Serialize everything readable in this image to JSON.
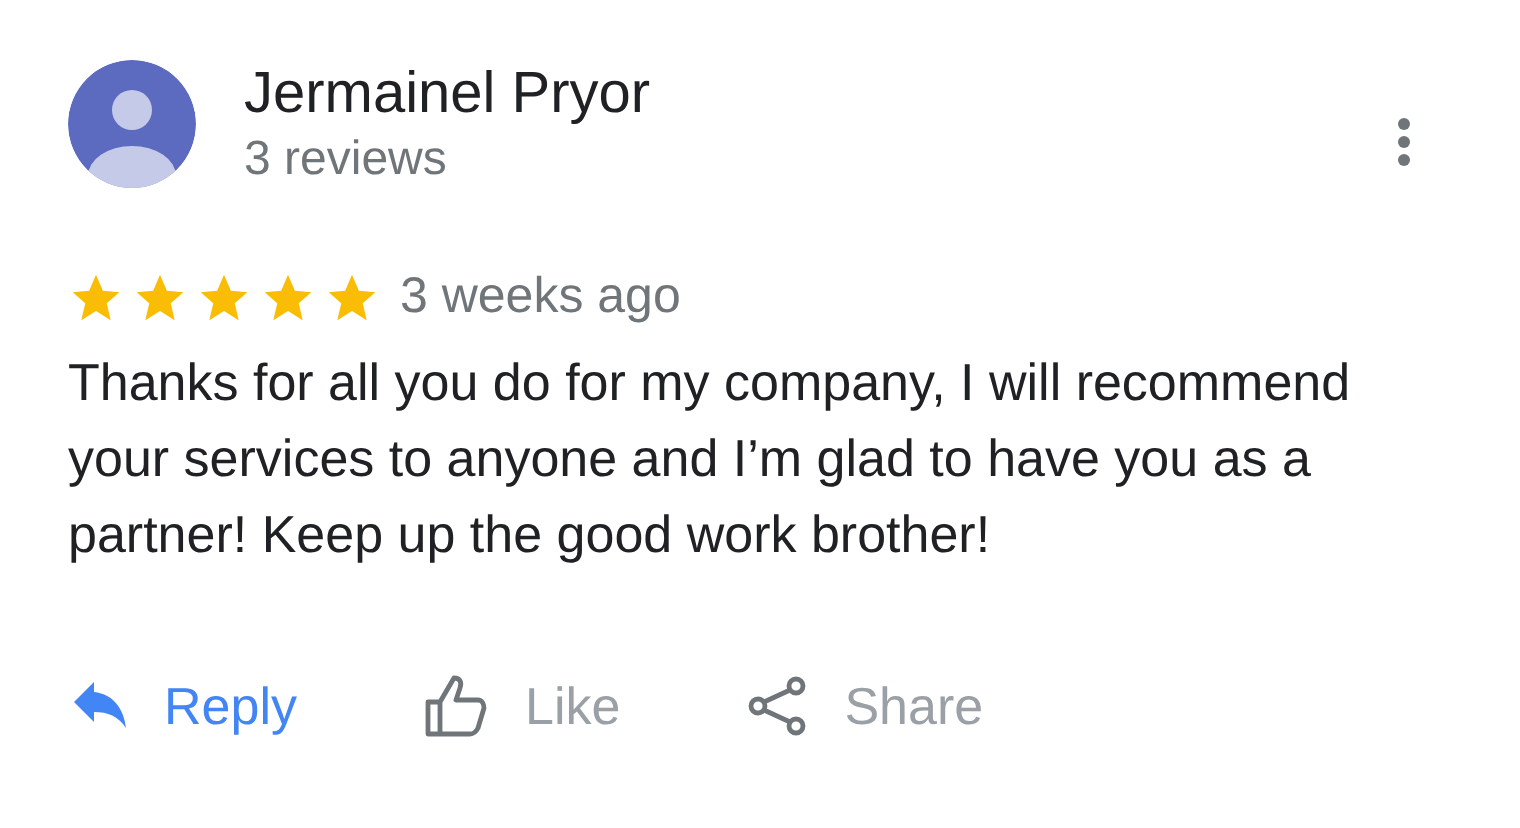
{
  "review": {
    "author": "Jermainel Pryor",
    "review_count": "3 reviews",
    "stars": 5,
    "time": "3 weeks ago",
    "text": "Thanks for all you do for my company, I will recommend your services to anyone and I’m glad to have you as a partner! Keep up the good work brother!"
  },
  "actions": [
    {
      "kind": "reply",
      "label": "Reply"
    },
    {
      "kind": "like",
      "label": "Like"
    },
    {
      "kind": "share",
      "label": "Share"
    }
  ]
}
